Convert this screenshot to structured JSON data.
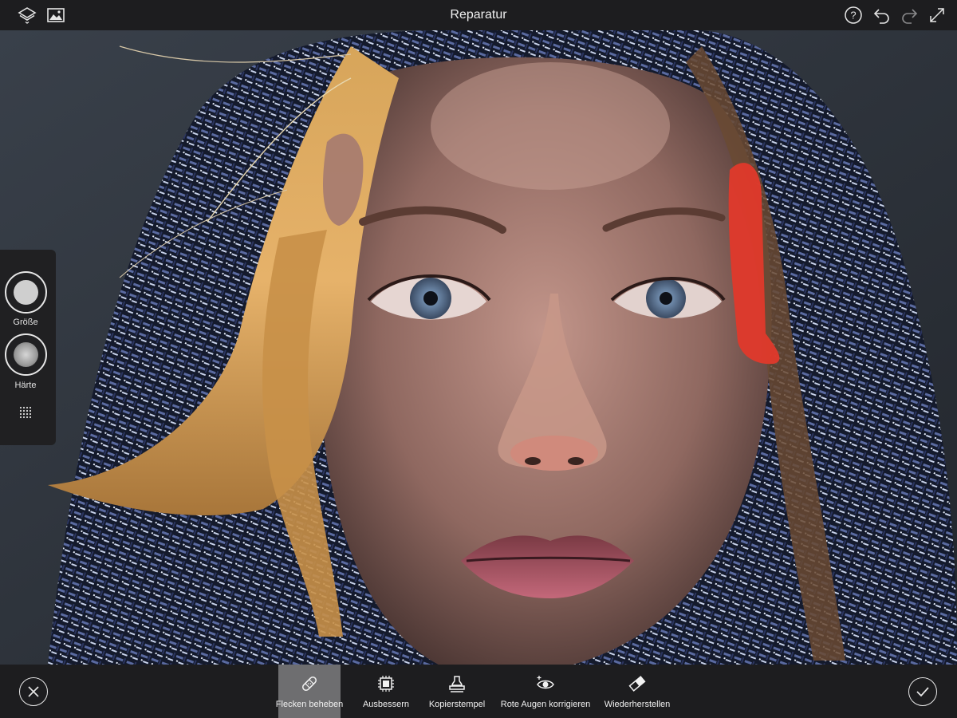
{
  "header": {
    "title": "Reparatur",
    "left_icons": [
      "layers-icon",
      "image-icon"
    ],
    "right_icons": [
      "help-icon",
      "undo-icon",
      "redo-icon",
      "expand-icon"
    ]
  },
  "brush_panel": {
    "size_label": "Größe",
    "hardness_label": "Härte",
    "grid_icon": "brush-grid-icon"
  },
  "toolbar": {
    "cancel_icon": "close-icon",
    "confirm_icon": "check-icon",
    "tools": [
      {
        "label": "Flecken beheben",
        "icon": "bandage-icon",
        "active": true
      },
      {
        "label": "Ausbessern",
        "icon": "patch-icon",
        "active": false
      },
      {
        "label": "Kopierstempel",
        "icon": "stamp-icon",
        "active": false
      },
      {
        "label": "Rote Augen korrigieren",
        "icon": "red-eye-icon",
        "active": false
      },
      {
        "label": "Wiederherstellen",
        "icon": "eraser-icon",
        "active": false
      }
    ]
  },
  "colors": {
    "accent_stroke": "#e0392b",
    "active_tool_bg": "#6e6e70",
    "bar_bg": "#1d1d1f"
  }
}
